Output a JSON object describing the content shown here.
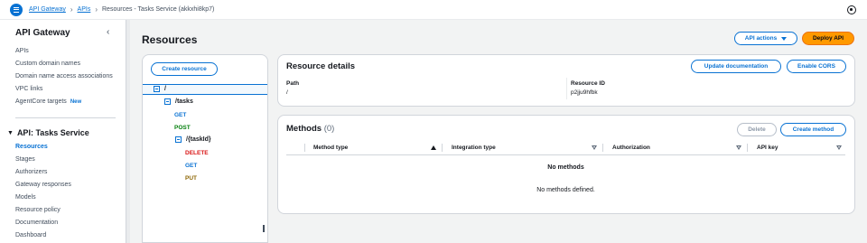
{
  "breadcrumb": {
    "items": [
      "API Gateway",
      "APIs"
    ],
    "current": "Resources - Tasks Service (akkxhi8kp7)"
  },
  "sidebar": {
    "title": "API Gateway",
    "top_items": [
      "APIs",
      "Custom domain names",
      "Domain name access associations",
      "VPC links",
      "AgentCore targets"
    ],
    "new_badge": "New",
    "section_title": "API: Tasks Service",
    "section_items": [
      "Resources",
      "Stages",
      "Authorizers",
      "Gateway responses",
      "Models",
      "Resource policy",
      "Documentation",
      "Dashboard"
    ],
    "active_item": "Resources"
  },
  "page": {
    "title": "Resources",
    "api_actions_label": "API actions",
    "deploy_label": "Deploy API"
  },
  "tree": {
    "create_resource_label": "Create resource",
    "root": "/",
    "tasks": "/tasks",
    "task_id": "/{taskId}",
    "methods": {
      "tasks_get": "GET",
      "tasks_post": "POST",
      "taskid_delete": "DELETE",
      "taskid_get": "GET",
      "taskid_put": "PUT"
    }
  },
  "resource_details": {
    "title": "Resource details",
    "update_doc_label": "Update documentation",
    "enable_cors_label": "Enable CORS",
    "path_label": "Path",
    "path_value": "/",
    "resource_id_label": "Resource ID",
    "resource_id_value": "p2jju9hfbk"
  },
  "methods": {
    "title": "Methods",
    "count": "(0)",
    "delete_label": "Delete",
    "create_label": "Create method",
    "columns": [
      "Method type",
      "Integration type",
      "Authorization",
      "API key"
    ],
    "empty_title": "No methods",
    "empty_desc": "No methods defined."
  },
  "colors": {
    "accent": "#0972d3",
    "primary_button": "#ff9900",
    "post": "#037f0c",
    "delete": "#d91515",
    "put": "#8d6605"
  }
}
